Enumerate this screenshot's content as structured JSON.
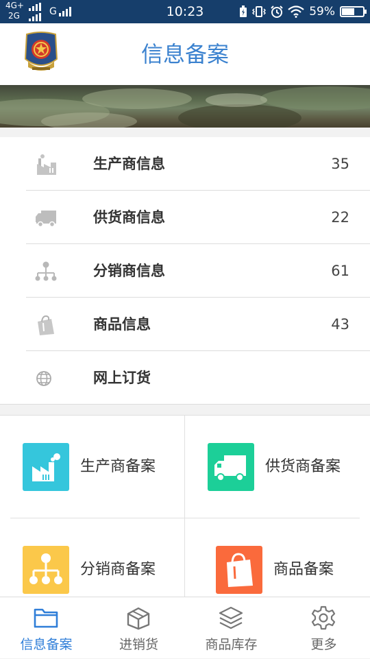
{
  "status_bar": {
    "network_top": "4G+",
    "network_bottom": "2G",
    "network_g": "G",
    "time": "10:23",
    "battery_percent": "59%",
    "battery_level": 0.59
  },
  "header": {
    "title": "信息备案",
    "emblem_icon": "national-emblem-icon"
  },
  "list": [
    {
      "label": "生产商信息",
      "count": "35",
      "icon": "factory-icon"
    },
    {
      "label": "供货商信息",
      "count": "22",
      "icon": "truck-icon"
    },
    {
      "label": "分销商信息",
      "count": "61",
      "icon": "distribution-tree-icon"
    },
    {
      "label": "商品信息",
      "count": "43",
      "icon": "shopping-bag-icon"
    },
    {
      "label": "网上订货",
      "count": "",
      "icon": "globe-icon"
    }
  ],
  "tiles": [
    {
      "label": "生产商备案",
      "icon": "factory-icon",
      "color": "#35c6dc"
    },
    {
      "label": "供货商备案",
      "icon": "truck-icon",
      "color": "#1ccf98"
    },
    {
      "label": "分销商备案",
      "icon": "distribution-tree-icon",
      "color": "#fbc84a"
    },
    {
      "label": "商品备案",
      "icon": "shopping-bag-icon",
      "color": "#fa6a3c"
    }
  ],
  "tabs": [
    {
      "label": "信息备案",
      "icon": "folder-icon",
      "active": true
    },
    {
      "label": "进销货",
      "icon": "box-icon",
      "active": false
    },
    {
      "label": "商品库存",
      "icon": "layers-icon",
      "active": false
    },
    {
      "label": "更多",
      "icon": "gear-icon",
      "active": false
    }
  ],
  "colors": {
    "status_bar": "#163e6b",
    "accent": "#3b82cf",
    "tab_active": "#2f7ed8",
    "icon_gray": "#b0b0b0"
  }
}
